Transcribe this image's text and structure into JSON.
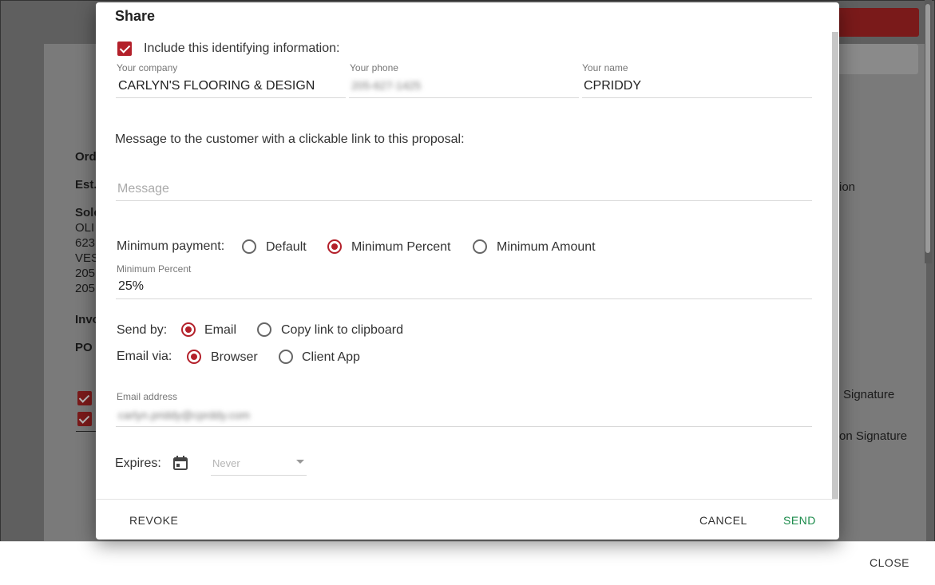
{
  "background": {
    "footer_close": "CLOSE",
    "left_fragments": [
      "Ord",
      "Est.",
      "Solc",
      "OLI",
      "623",
      "VES",
      "205",
      "205",
      "Invo",
      "PO"
    ],
    "right_fragments": [
      "ion",
      "Signature",
      "on Signature"
    ]
  },
  "dialog": {
    "title": "Share",
    "include_label": "Include this identifying information:",
    "company": {
      "label": "Your company",
      "value": "CARLYN'S FLOORING & DESIGN"
    },
    "phone": {
      "label": "Your phone",
      "value": "205-627-1425"
    },
    "name": {
      "label": "Your name",
      "value": "CPRIDDY"
    },
    "message_intro": "Message to the customer with a clickable link to this proposal:",
    "message_placeholder": "Message",
    "min_payment": {
      "label": "Minimum payment:",
      "options": [
        "Default",
        "Minimum Percent",
        "Minimum Amount"
      ],
      "selected": "Minimum Percent"
    },
    "min_percent": {
      "label": "Minimum Percent",
      "value": "25%"
    },
    "send_by": {
      "label": "Send by:",
      "options": [
        "Email",
        "Copy link to clipboard"
      ],
      "selected": "Email"
    },
    "email_via": {
      "label": "Email via:",
      "options": [
        "Browser",
        "Client App"
      ],
      "selected": "Browser"
    },
    "email": {
      "label": "Email address",
      "value": "carlyn.priddy@cprddy.com"
    },
    "expires": {
      "label": "Expires:",
      "value": "Never"
    },
    "buttons": {
      "revoke": "REVOKE",
      "cancel": "CANCEL",
      "send": "SEND"
    },
    "colors": {
      "accent": "#b3202a",
      "send": "#1a8a4a"
    }
  }
}
